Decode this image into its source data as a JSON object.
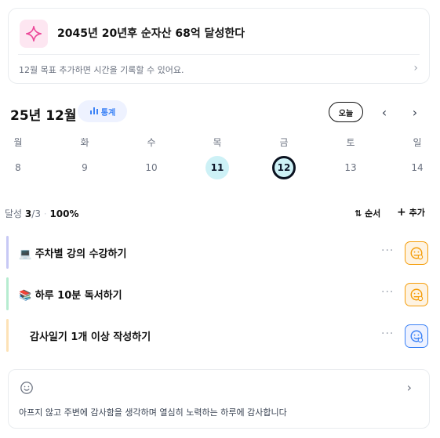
{
  "goal": {
    "title": "2045년 20년후 순자산 68억 달성한다",
    "hint": "12월 목표  추가하면 시간을 기록할 수 있어요.",
    "chevron": "›"
  },
  "calendar": {
    "month_label": "25년 12월",
    "stats_label": "통계",
    "today_label": "오늘",
    "prev": "‹",
    "next": "›",
    "weekdays": [
      "월",
      "화",
      "수",
      "목",
      "금",
      "토",
      "일"
    ],
    "days": [
      "8",
      "9",
      "10",
      "11",
      "12",
      "13",
      "14"
    ]
  },
  "progress": {
    "label": "달성",
    "count_done": "3",
    "count_total": "/3",
    "percent": "100%",
    "order_label": "순서",
    "add_label": "추가"
  },
  "tasks": [
    {
      "label": "💻 주차별 강의 수강하기",
      "bar_color": "#c7c9f5",
      "face": "orange"
    },
    {
      "label": "📚 하루 10분 독서하기",
      "bar_color": "#b6ecd0",
      "face": "orange"
    },
    {
      "label": "감사일기 1개 이상 작성하기",
      "bar_color": "#fde2b6",
      "face": "blue"
    }
  ],
  "task_more": "···",
  "gratitude": {
    "text": "아프지 않고 주변에 감사함을 생각하며 열심히 노력하는 하루에 감사합니다",
    "chevron": "›"
  },
  "colors": {
    "accent_blue": "#3b82f6",
    "accent_orange": "#f59e0b",
    "done_day": "#cdf1f6"
  }
}
